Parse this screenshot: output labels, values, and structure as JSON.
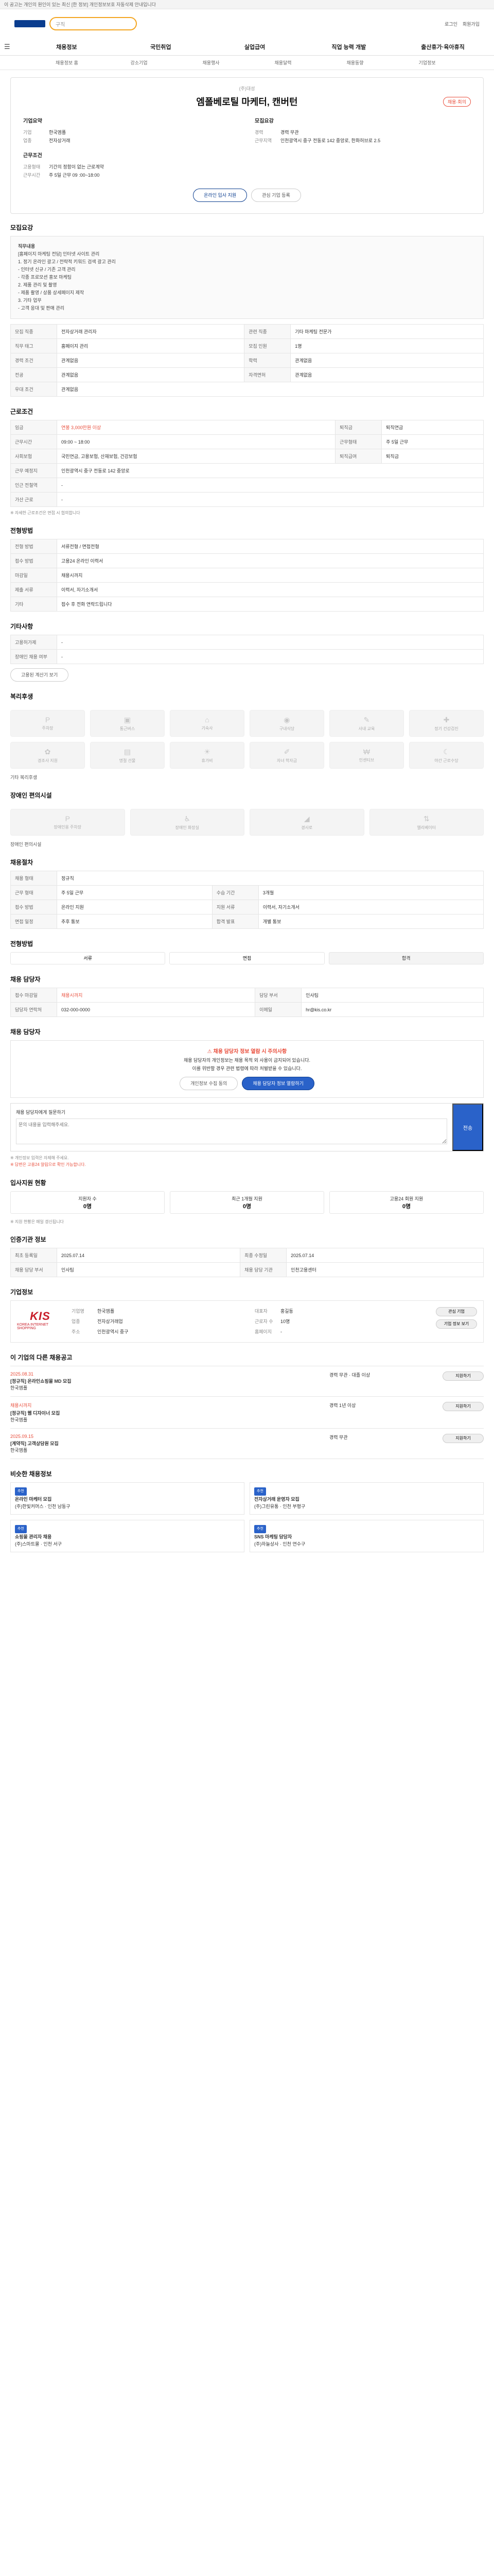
{
  "topbar": {
    "notice": "이 공고는 개인의 원인이 있는 최신 [한 정보] 개인정보보호 자동삭제 안내입니다"
  },
  "header": {
    "search_placeholder": "구직",
    "links": [
      "로그인",
      "회원가입"
    ]
  },
  "gnb": [
    "채용정보",
    "국민취업",
    "실업급여",
    "직업 능력 개발",
    "출산휴가·육아휴직"
  ],
  "lnb": [
    "채용정보 홈",
    "강소기업",
    "채용행사",
    "채용달력",
    "채용동향",
    "기업정보"
  ],
  "job": {
    "pre": "(주)대성",
    "title": "엠폴베로틸 마케터, 캔버턴",
    "tag": "채용·회의",
    "company_h": "기업요약",
    "recruit_h": "모집요강",
    "company": [
      {
        "k": "기업",
        "v": "한국엠폴"
      },
      {
        "k": "업종",
        "v": "전자상거래"
      }
    ],
    "recruit": [
      {
        "k": "경력",
        "v": "경력 무관"
      },
      {
        "k": "근무지역",
        "v": "인천광역시 중구 전동로 142 중앙로, 한화허브로 2.5"
      }
    ],
    "recruit_h2": "근무조건",
    "cond": [
      {
        "k": "고용형태",
        "v": "기간의 정함이 없는 근로계약"
      },
      {
        "k": "근무시간",
        "v": "주 5일 근무 09 :00~18:00"
      }
    ],
    "btn_apply": "온라인 입사 지원",
    "btn_scrap": "관심 기업 등록"
  },
  "intro": {
    "h": "모집요강",
    "lines": [
      "직무내용",
      "[홈페이지 마케팅 전담] 인터넷 사이트 관리",
      "1. 정기 온라인 광고 / 전략적 키워드 검색 광고 관리",
      "- 인터넷 신규 / 기존 고객 관리",
      "- 각종 프로모션 홍보 마케팅",
      "2. 제품 관리 및 촬영",
      "- 제품 촬영 / 상품 상세페이지 제작",
      "3. 기타 업무",
      "- 고객 응대 및 판매 관리"
    ]
  },
  "table1": [
    {
      "k": "모집 직종",
      "v": "전자상거래 관리자",
      "k2": "관련 직종",
      "v2": "기타 마케팅 전문가"
    },
    {
      "k": "직무 태그",
      "v": "홈페이지 관리",
      "k2": "모집 인원",
      "v2": "1명"
    },
    {
      "k": "경력 조건",
      "v": "관계없음",
      "k2": "학력",
      "v2": "관계없음"
    },
    {
      "k": "전공",
      "v": "관계없음",
      "k2": "자격면허",
      "v2": "관계없음"
    },
    {
      "k": "우대 조건",
      "v": "관계없음",
      "k2": "",
      "v2": ""
    }
  ],
  "cond": {
    "h": "근로조건",
    "rows": [
      {
        "k": "임금",
        "v": "연봉 3,000만원 이상",
        "k2": "퇴직금",
        "v2": "퇴직연금"
      },
      {
        "k": "근무시간",
        "v": "09:00 ~ 18:00",
        "k2": "근무형태",
        "v2": "주 5일 근무"
      },
      {
        "k": "사회보험",
        "v": "국민연금, 고용보험, 산재보험, 건강보험",
        "k2": "퇴직급여",
        "v2": "퇴직금"
      },
      {
        "k": "근무 예정지",
        "v": "인천광역시 중구 전동로 142 중앙로",
        "k2": "",
        "v2": ""
      },
      {
        "k": "인근 전철역",
        "v": "-",
        "k2": "",
        "v2": ""
      },
      {
        "k": "가산 근로",
        "v": "-",
        "k2": "",
        "v2": ""
      }
    ],
    "note": "※ 자세한 근로조건은 면접 시 협의합니다"
  },
  "apply": {
    "h": "전형방법",
    "rows": [
      {
        "k": "전형 방법",
        "v": "서류전형 / 면접전형"
      },
      {
        "k": "접수 방법",
        "v": "고용24 온라인 이력서"
      },
      {
        "k": "마감일",
        "v": "채용시까지"
      },
      {
        "k": "제출 서류",
        "v": "이력서, 자기소개서"
      },
      {
        "k": "기타",
        "v": "접수 후 전화 연락드립니다"
      }
    ]
  },
  "etc": {
    "h": "기타사항",
    "rows": [
      {
        "k": "고용허가제",
        "v": "-"
      },
      {
        "k": "장애인 채용 여부",
        "v": "-"
      }
    ],
    "link": "고용된 계산기 보기"
  },
  "welfare": {
    "h": "복리후생",
    "items": [
      "주차장",
      "통근버스",
      "기숙사",
      "구내식당",
      "사내 교육",
      "정기 건강검진",
      "경조사 지원",
      "명절 선물",
      "휴가비",
      "자녀 학자금",
      "인센티브",
      "야간 근로수당"
    ],
    "note": "기타 복리후생"
  },
  "disabled": {
    "h": "장애인 편의시설",
    "items": [
      "장애인용 주차장",
      "장애인 화장실",
      "경사로",
      "엘리베이터"
    ],
    "note": "장애인 편의시설"
  },
  "process": {
    "h": "채용절차",
    "rows": [
      {
        "k": "채용 형태",
        "v": "정규직"
      },
      {
        "k": "근무 형태",
        "v": "주 5일 근무",
        "k2": "수습 기간",
        "v2": "3개월"
      },
      {
        "k": "접수 방법",
        "v": "온라인 지원",
        "k2": "지원 서류",
        "v2": "이력서, 자기소개서"
      },
      {
        "k": "면접 일정",
        "v": "추후 통보",
        "k2": "합격 발표",
        "v2": "개별 통보"
      }
    ]
  },
  "flow": {
    "h": "전형방법",
    "steps": [
      "서류",
      "면접",
      "합격"
    ]
  },
  "contact": {
    "h": "채용 담당자",
    "rows": [
      {
        "k": "접수 마감일",
        "v": "채용시까지",
        "k2": "담당 부서",
        "v2": "인사팀"
      },
      {
        "k": "담당자 연락처",
        "v": "032-000-0000",
        "k2": "이메일",
        "v2": "hr@kis.co.kr"
      }
    ]
  },
  "warn": {
    "h": "채용 담당자",
    "w": "채용 담당자 정보 열람 시 주의사항",
    "lines": [
      "채용 담당자의 개인정보는 채용 목적 외 사용이 금지되어 있습니다.",
      "이를 위반할 경우 관련 법령에 따라 처벌받을 수 있습니다."
    ],
    "btn1": "개인정보 수집 동의",
    "btn2": "채용 담당자 정보 열람하기"
  },
  "message": {
    "label": "채용 담당자에게 질문하기",
    "placeholder": "문의 내용을 입력해주세요.",
    "send": "전송",
    "notes": [
      "※ 개인정보 입력은 자제해 주세요.",
      "※ 답변은 고용24 알림으로 확인 가능합니다."
    ]
  },
  "stats": {
    "h": "입사지원 현황",
    "items": [
      {
        "k": "지원자 수",
        "v": "0명"
      },
      {
        "k": "최근 1개월 지원",
        "v": "0명"
      },
      {
        "k": "고용24 회원 지원",
        "v": "0명"
      }
    ],
    "note": "※ 지원 현황은 매일 갱신됩니다"
  },
  "info": {
    "h": "인증기관 정보",
    "rows": [
      {
        "k": "최초 등록일",
        "v": "2025.07.14",
        "k2": "최종 수정일",
        "v2": "2025.07.14"
      },
      {
        "k": "채용 담당 부서",
        "v": "인사팀",
        "k2": "채용 담당 기관",
        "v2": "인천고용센터"
      }
    ]
  },
  "company": {
    "h": "기업정보",
    "logo": "KIS",
    "logo_sub": "KOREA INTERNET SHOPPING",
    "rows": [
      {
        "k": "기업명",
        "v": "한국엠폴"
      },
      {
        "k": "대표자",
        "v": "홍길동"
      },
      {
        "k": "업종",
        "v": "전자상거래업"
      },
      {
        "k": "근로자 수",
        "v": "10명"
      },
      {
        "k": "주소",
        "v": "인천광역시 중구"
      },
      {
        "k": "홈페이지",
        "v": "-"
      }
    ],
    "btn1": "관심 기업",
    "btn2": "기업 정보 보기"
  },
  "others": {
    "h": "이 기업의 다른 채용공고",
    "jobs": [
      {
        "title": "[정규직] 온라인쇼핑몰 MD 모집",
        "a": "한국엠폴",
        "b": "경력 무관 · 대졸 이상",
        "c": "2025.08.31",
        "btn": "지원하기"
      },
      {
        "title": "[정규직] 웹 디자이너 모집",
        "a": "한국엠폴",
        "b": "경력 1년 이상",
        "c": "채용시까지",
        "btn": "지원하기"
      },
      {
        "title": "[계약직] 고객상담원 모집",
        "a": "한국엠폴",
        "b": "경력 무관",
        "c": "2025.09.15",
        "btn": "지원하기"
      }
    ]
  },
  "recommend": {
    "h": "비슷한 채용정보",
    "cards": [
      {
        "tag": "추천",
        "title": "온라인 마케터 모집",
        "sub": "(주)한빛커머스 · 인천 남동구"
      },
      {
        "tag": "추천",
        "title": "전자상거래 운영자 모집",
        "sub": "(주)그린유통 · 인천 부평구"
      },
      {
        "tag": "추천",
        "title": "쇼핑몰 관리자 채용",
        "sub": "(주)스마트몰 · 인천 서구"
      },
      {
        "tag": "추천",
        "title": "SNS 마케팅 담당자",
        "sub": "(주)하늘상사 · 인천 연수구"
      }
    ]
  }
}
